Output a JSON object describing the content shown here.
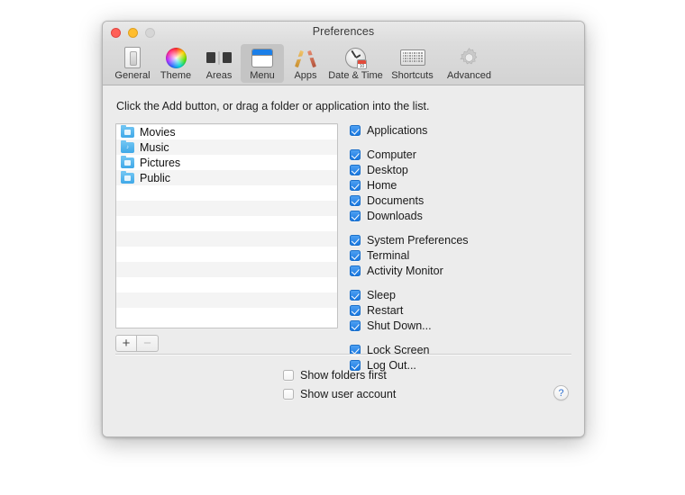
{
  "window": {
    "title": "Preferences",
    "traffic_lights": [
      "close-button",
      "minimize-button",
      "zoom-button"
    ]
  },
  "toolbar": {
    "items": [
      {
        "label": "General",
        "icon": "toggle-switch-icon",
        "selected": false
      },
      {
        "label": "Theme",
        "icon": "color-wheel-icon",
        "selected": false
      },
      {
        "label": "Areas",
        "icon": "split-panes-icon",
        "selected": false
      },
      {
        "label": "Menu",
        "icon": "window-menu-icon",
        "selected": true
      },
      {
        "label": "Apps",
        "icon": "app-store-icon",
        "selected": false
      },
      {
        "label": "Date & Time",
        "icon": "clock-calendar-icon",
        "selected": false
      },
      {
        "label": "Shortcuts",
        "icon": "keyboard-icon",
        "selected": false
      },
      {
        "label": "Advanced",
        "icon": "gear-icon",
        "selected": false
      }
    ]
  },
  "content": {
    "hint": "Click the Add button, or drag a folder or application into the list.",
    "folder_list": {
      "items": [
        {
          "name": "Movies",
          "icon": "folder-movies-icon"
        },
        {
          "name": "Music",
          "icon": "folder-music-icon"
        },
        {
          "name": "Pictures",
          "icon": "folder-pictures-icon"
        },
        {
          "name": "Public",
          "icon": "folder-public-icon"
        }
      ],
      "empty_rows": 9
    },
    "list_buttons": {
      "add_label": "+",
      "remove_label": "−",
      "add_enabled": true,
      "remove_enabled": false
    },
    "checkbox_groups": [
      {
        "group": "applications",
        "items": [
          {
            "label": "Applications",
            "checked": true
          }
        ]
      },
      {
        "group": "locations",
        "items": [
          {
            "label": "Computer",
            "checked": true
          },
          {
            "label": "Desktop",
            "checked": true
          },
          {
            "label": "Home",
            "checked": true
          },
          {
            "label": "Documents",
            "checked": true
          },
          {
            "label": "Downloads",
            "checked": true
          }
        ]
      },
      {
        "group": "utilities",
        "items": [
          {
            "label": "System Preferences",
            "checked": true
          },
          {
            "label": "Terminal",
            "checked": true
          },
          {
            "label": "Activity Monitor",
            "checked": true
          }
        ]
      },
      {
        "group": "power",
        "items": [
          {
            "label": "Sleep",
            "checked": true
          },
          {
            "label": "Restart",
            "checked": true
          },
          {
            "label": "Shut Down...",
            "checked": true
          }
        ]
      },
      {
        "group": "session",
        "items": [
          {
            "label": "Lock Screen",
            "checked": true
          },
          {
            "label": "Log Out...",
            "checked": true
          }
        ]
      }
    ],
    "bottom_options": [
      {
        "label": "Show folders first",
        "checked": false
      },
      {
        "label": "Show user account",
        "checked": false
      }
    ],
    "help_button": {
      "label": "?",
      "icon": "help-icon"
    }
  },
  "colors": {
    "accent": "#1877e0",
    "window_bg": "#ececec",
    "toolbar_bg": "#d8d8d8",
    "selected_tab_bg": "#c4c4c4",
    "folder_blue": "#3fa8e8",
    "help_blue": "#2e6fd0"
  }
}
